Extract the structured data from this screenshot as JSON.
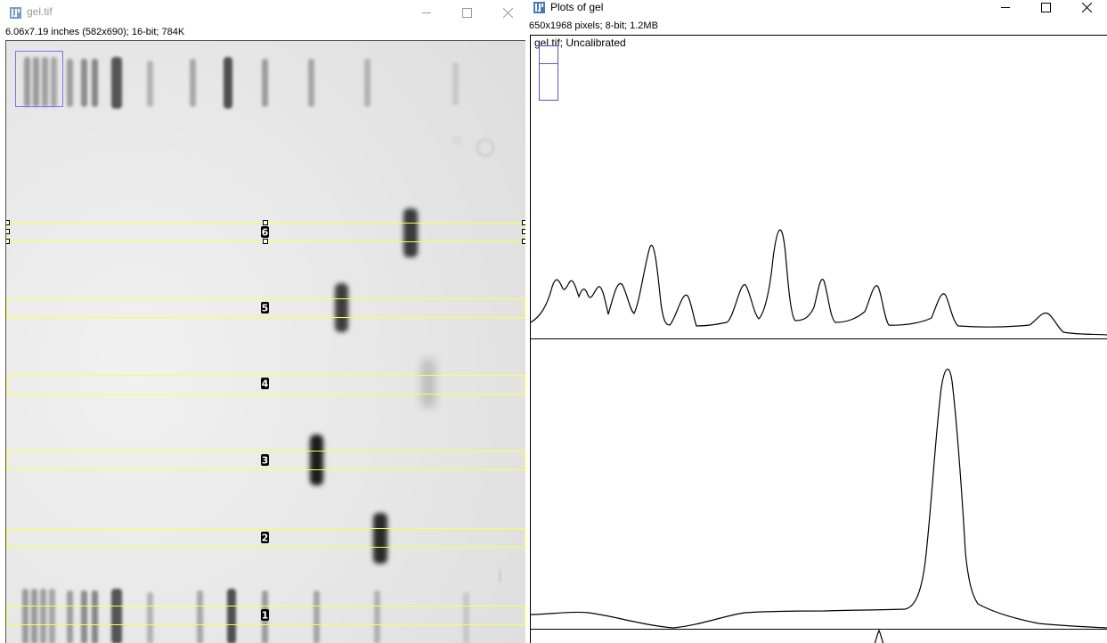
{
  "gel_window": {
    "title": "gel.tif",
    "info": "6.06x7.19 inches (582x690); 16-bit; 784K",
    "icon": "imagej-icon",
    "lane_labels": [
      "1",
      "2",
      "3",
      "4",
      "5",
      "6"
    ],
    "controls": [
      "minimize-icon",
      "maximize-icon",
      "close-icon"
    ]
  },
  "plots_window": {
    "title": "Plots of gel",
    "info": "650x1968 pixels; 8-bit; 1.2MB",
    "caption": "gel.tif; Uncalibrated",
    "icon": "imagej-icon",
    "controls": [
      "minimize-icon",
      "maximize-icon",
      "close-icon"
    ]
  },
  "colors": {
    "roi": "#ffff44",
    "selection": "#7777ee",
    "gel_background": "#e4e4e4",
    "band": "#222222"
  }
}
